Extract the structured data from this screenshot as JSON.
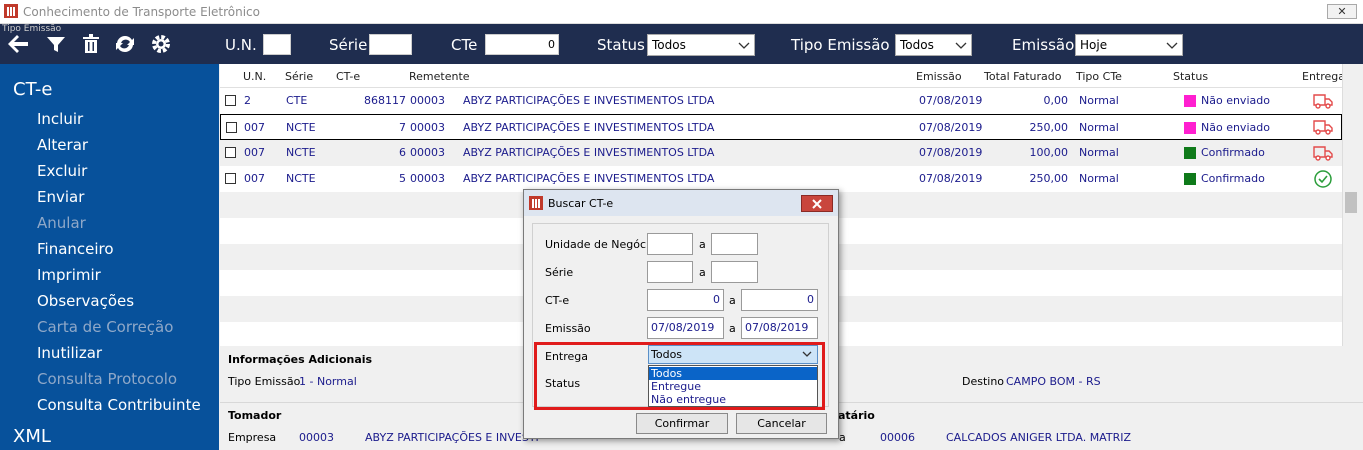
{
  "window": {
    "title": "Conhecimento de Transporte Eletrônico",
    "close_label": "✕"
  },
  "toolbar": {
    "mini_label": "Tipo Emissão",
    "un_label": "U.N.",
    "un_value": "",
    "serie_label": "Série",
    "serie_value": "",
    "cte_label": "CTe",
    "cte_value": "0",
    "status_label": "Status",
    "status_value": "Todos",
    "tipo_label": "Tipo Emissão",
    "tipo_value": "Todos",
    "emissao_label": "Emissão",
    "emissao_value": "Hoje"
  },
  "sidebar": {
    "section_cte": "CT-e",
    "items": [
      {
        "label": "Incluir",
        "enabled": true
      },
      {
        "label": "Alterar",
        "enabled": true
      },
      {
        "label": "Excluir",
        "enabled": true
      },
      {
        "label": "Enviar",
        "enabled": true
      },
      {
        "label": "Anular",
        "enabled": false
      },
      {
        "label": "Financeiro",
        "enabled": true
      },
      {
        "label": "Imprimir",
        "enabled": true
      },
      {
        "label": "Observações",
        "enabled": true
      },
      {
        "label": "Carta de Correção",
        "enabled": false
      },
      {
        "label": "Inutilizar",
        "enabled": true
      },
      {
        "label": "Consulta Protocolo",
        "enabled": false
      },
      {
        "label": "Consulta Contribuinte",
        "enabled": true
      }
    ],
    "section_xml": "XML"
  },
  "table": {
    "columns": [
      "U.N.",
      "Série",
      "CT-e",
      "Remetente",
      "Emissão",
      "Total Faturado",
      "Tipo CTe",
      "Status",
      "Entrega"
    ],
    "rows": [
      {
        "un": "2",
        "serie": "CTE",
        "cte": "868117",
        "rem_cod": "00003",
        "rem_nome": "ABYZ PARTICIPAÇÕES E INVESTIMENTOS LTDA",
        "emissao": "07/08/2019",
        "total": "0,00",
        "tipo": "Normal",
        "status": "Não enviado",
        "status_color": "#ff1fd0",
        "entrega_icon": "truck-icon"
      },
      {
        "un": "007",
        "serie": "NCTE",
        "cte": "7",
        "rem_cod": "00003",
        "rem_nome": "ABYZ PARTICIPAÇÕES E INVESTIMENTOS LTDA",
        "emissao": "07/08/2019",
        "total": "250,00",
        "tipo": "Normal",
        "status": "Não enviado",
        "status_color": "#ff1fd0",
        "entrega_icon": "truck-icon"
      },
      {
        "un": "007",
        "serie": "NCTE",
        "cte": "6",
        "rem_cod": "00003",
        "rem_nome": "ABYZ PARTICIPAÇÕES E INVESTIMENTOS LTDA",
        "emissao": "07/08/2019",
        "total": "100,00",
        "tipo": "Normal",
        "status": "Confirmado",
        "status_color": "#0f7a1a",
        "entrega_icon": "truck-icon"
      },
      {
        "un": "007",
        "serie": "NCTE",
        "cte": "5",
        "rem_cod": "00003",
        "rem_nome": "ABYZ PARTICIPAÇÕES E INVESTIMENTOS LTDA",
        "emissao": "07/08/2019",
        "total": "250,00",
        "tipo": "Normal",
        "status": "Confirmado",
        "status_color": "#0f7a1a",
        "entrega_icon": "check-circle-icon"
      }
    ]
  },
  "info": {
    "adicionais_title": "Informações Adicionais",
    "tipo_emissao_label": "Tipo Emissão",
    "tipo_emissao_value": "1 - Normal",
    "destino_label": "Destino",
    "destino_value": "CAMPO BOM - RS",
    "tomador_title": "Tomador",
    "empresa_label": "Empresa",
    "empresa_cod": "00003",
    "empresa_nome": "ABYZ PARTICIPAÇÕES E INVESTI",
    "destinatario_title_partial": "atário",
    "dest_label_partial": "a",
    "dest_cod": "00006",
    "dest_nome": "CALCADOS ANIGER LTDA. MATRIZ"
  },
  "dialog": {
    "title": "Buscar CT-e",
    "un_label": "Unidade de Negócio",
    "a_label": "a",
    "serie_label": "Série",
    "cte_label": "CT-e",
    "cte_from": "0",
    "cte_to": "0",
    "emissao_label": "Emissão",
    "emissao_from": "07/08/2019",
    "emissao_to": "07/08/2019",
    "entrega_label": "Entrega",
    "entrega_value": "Todos",
    "entrega_options": [
      "Todos",
      "Entregue",
      "Não entregue"
    ],
    "status_label": "Status",
    "confirm_label": "Confirmar",
    "cancel_label": "Cancelar"
  },
  "colors": {
    "toolbar": "#1f2d4f",
    "sidebar": "#07519b",
    "highlight": "#e01b1b"
  }
}
